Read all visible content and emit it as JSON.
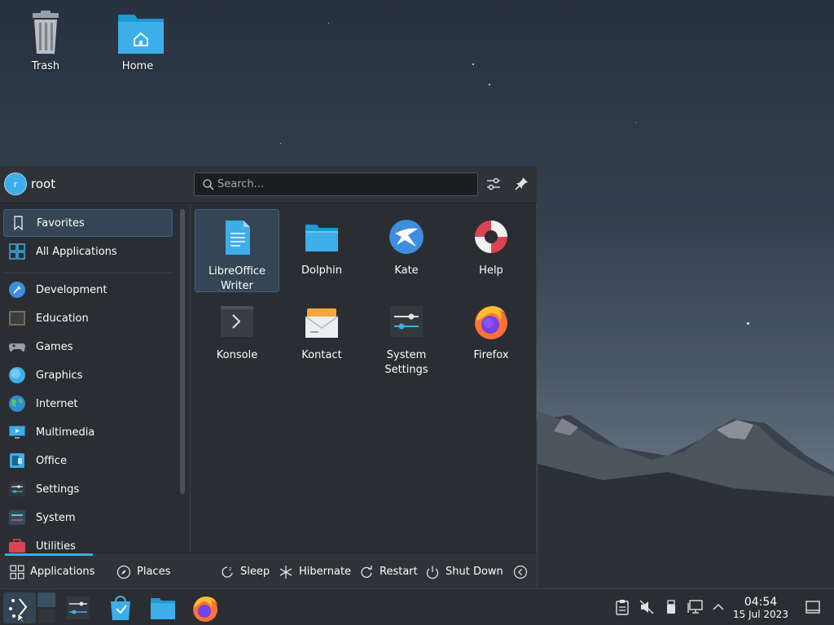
{
  "desktop": {
    "icons": [
      {
        "label": "Trash",
        "icon": "trash-icon"
      },
      {
        "label": "Home",
        "icon": "home-folder-icon"
      }
    ]
  },
  "menu": {
    "user": {
      "name": "root",
      "avatar_letter": "r"
    },
    "search": {
      "placeholder": "Search..."
    },
    "sidebar": {
      "items": [
        {
          "label": "Favorites",
          "icon": "bookmark-icon"
        },
        {
          "label": "All Applications",
          "icon": "grid-icon"
        },
        {
          "label": "Development",
          "icon": "development-icon"
        },
        {
          "label": "Education",
          "icon": "education-icon"
        },
        {
          "label": "Games",
          "icon": "gamepad-icon"
        },
        {
          "label": "Graphics",
          "icon": "graphics-icon"
        },
        {
          "label": "Internet",
          "icon": "globe-icon"
        },
        {
          "label": "Multimedia",
          "icon": "multimedia-icon"
        },
        {
          "label": "Office",
          "icon": "office-icon"
        },
        {
          "label": "Settings",
          "icon": "settings-icon"
        },
        {
          "label": "System",
          "icon": "system-icon"
        },
        {
          "label": "Utilities",
          "icon": "utilities-icon"
        }
      ]
    },
    "apps": [
      {
        "line1": "LibreOffice",
        "line2": "Writer",
        "icon": "libreoffice-writer-icon"
      },
      {
        "line1": "Dolphin",
        "line2": "",
        "icon": "dolphin-folder-icon"
      },
      {
        "line1": "Kate",
        "line2": "",
        "icon": "kate-icon"
      },
      {
        "line1": "Help",
        "line2": "",
        "icon": "help-lifebuoy-icon"
      },
      {
        "line1": "Konsole",
        "line2": "",
        "icon": "konsole-icon"
      },
      {
        "line1": "Kontact",
        "line2": "",
        "icon": "kontact-icon"
      },
      {
        "line1": "System",
        "line2": "Settings",
        "icon": "system-settings-icon"
      },
      {
        "line1": "Firefox",
        "line2": "",
        "icon": "firefox-icon"
      }
    ],
    "footer": {
      "applications": "Applications",
      "places": "Places",
      "sleep": "Sleep",
      "hibernate": "Hibernate",
      "restart": "Restart",
      "shutdown": "Shut Down"
    }
  },
  "taskbar": {
    "clock": {
      "time": "04:54",
      "date": "15 Jul 2023"
    }
  },
  "colors": {
    "accent": "#3daee9",
    "panel": "#2a2e32",
    "selection": "#354555"
  }
}
